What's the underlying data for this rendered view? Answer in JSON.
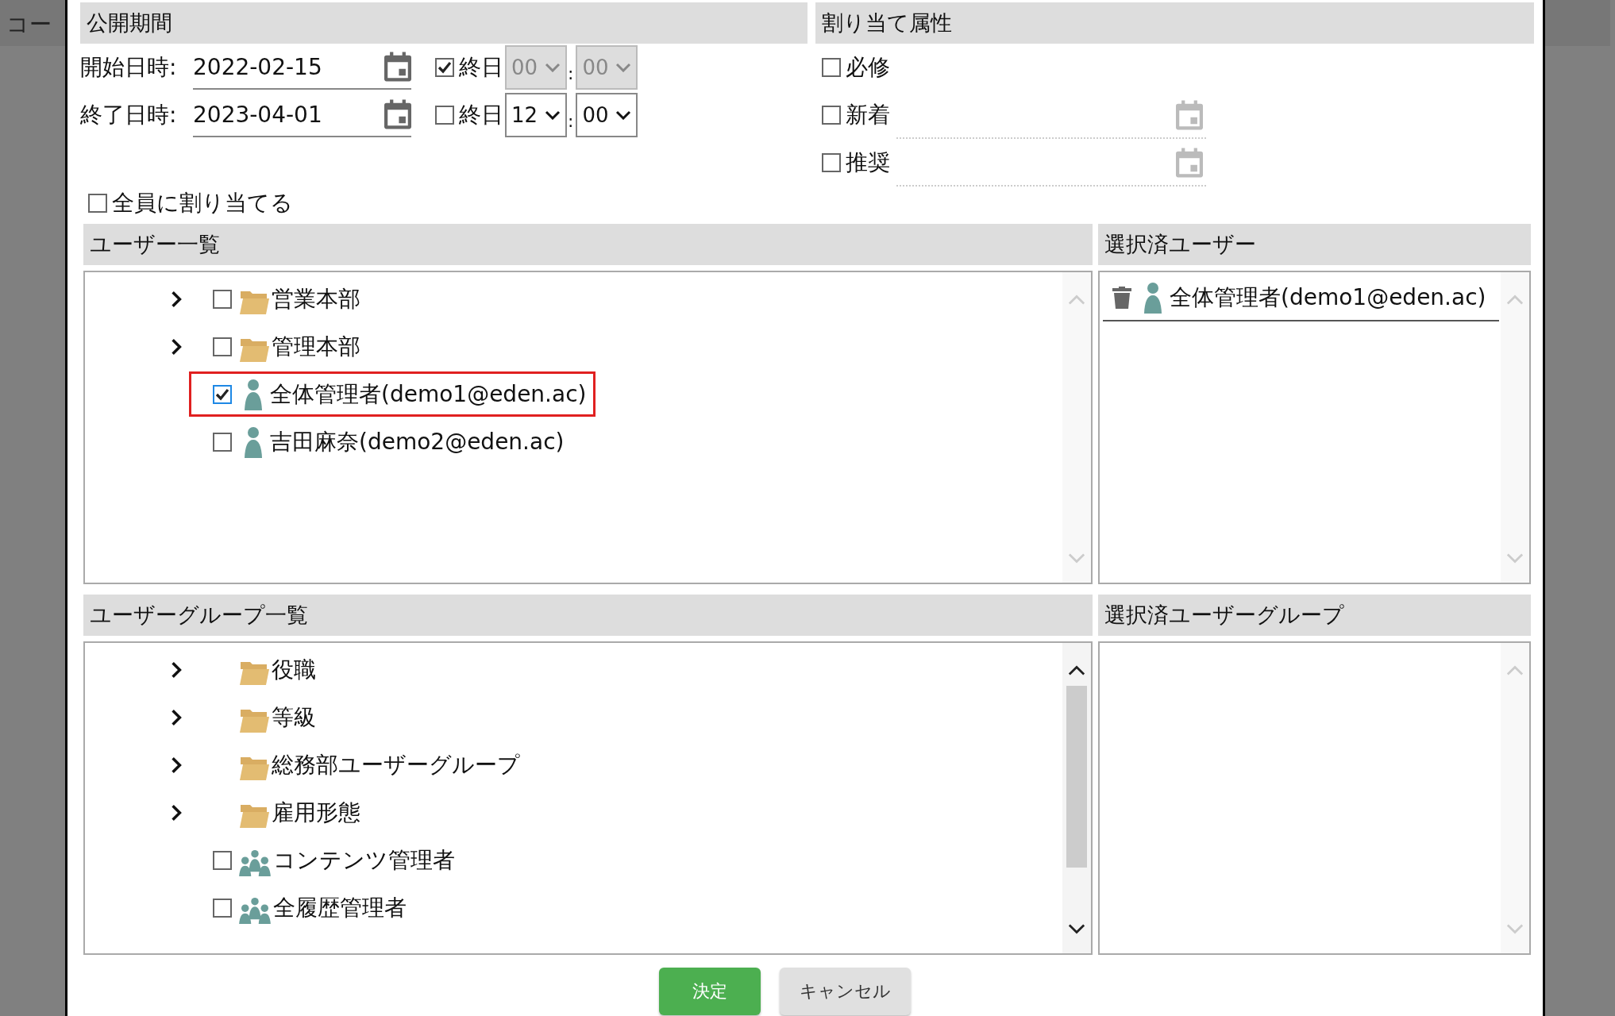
{
  "background": {
    "title": "コー"
  },
  "period": {
    "title": "公開期間",
    "rows": [
      {
        "label": "開始日時:",
        "value": "2022-02-15",
        "all_day": {
          "label": "終日",
          "checked": true
        },
        "hour": "00",
        "separator": ":",
        "minute": "00"
      },
      {
        "label": "終了日時:",
        "value": "2023-04-01",
        "all_day": {
          "label": "終日",
          "checked": false
        },
        "hour": "12",
        "separator": ":",
        "minute": "00"
      }
    ]
  },
  "attributes": {
    "title": "割り当て属性",
    "items": [
      {
        "kind": "plain",
        "label": "必修",
        "checked": false
      },
      {
        "kind": "date",
        "label": "新着",
        "checked": false
      },
      {
        "kind": "date",
        "label": "推奨",
        "checked": false
      }
    ]
  },
  "assign_all": {
    "label": "全員に割り当てる",
    "checked": false
  },
  "users": {
    "title": "ユーザー一覧",
    "items": [
      {
        "kind": "folder",
        "label": "営業本部",
        "checked": false,
        "expanded": false
      },
      {
        "kind": "folder",
        "label": "管理本部",
        "checked": false,
        "expanded": false
      },
      {
        "kind": "user",
        "label": "全体管理者(demo1@eden.ac)",
        "checked": true,
        "highlighted": true
      },
      {
        "kind": "user",
        "label": "吉田麻奈(demo2@eden.ac)",
        "checked": false,
        "highlighted": false
      }
    ]
  },
  "selected_users": {
    "title": "選択済ユーザー",
    "items": [
      {
        "label": "全体管理者(demo1@eden.ac)"
      }
    ]
  },
  "groups": {
    "title": "ユーザーグループ一覧",
    "items": [
      {
        "kind": "folder",
        "label": "役職",
        "expanded": false
      },
      {
        "kind": "folder",
        "label": "等級",
        "expanded": false
      },
      {
        "kind": "folder",
        "label": "総務部ユーザーグループ",
        "expanded": false
      },
      {
        "kind": "folder",
        "label": "雇用形態",
        "expanded": false
      },
      {
        "kind": "group",
        "label": "コンテンツ管理者",
        "checked": false
      },
      {
        "kind": "group",
        "label": "全履歴管理者",
        "checked": false
      }
    ]
  },
  "selected_groups": {
    "title": "選択済ユーザーグループ"
  },
  "buttons": [
    {
      "kind": "primary",
      "label": "決定"
    },
    {
      "kind": "secondary",
      "label": "キャンセル"
    }
  ]
}
